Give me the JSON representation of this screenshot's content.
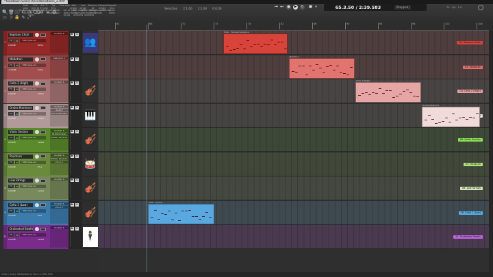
{
  "window": {
    "tab_title": "*Teardown-Score-Reverberations_2.RPP"
  },
  "toolbar": {
    "buttons": [
      "Auto color Color tracks",
      "Trim item to Color",
      "Act. Tr. E Color items",
      "Tgl. Env. Color items",
      "Overview",
      "Add empty take items",
      "Add empty take after",
      "Remove all empty takes",
      "Collapse empty take",
      "Explode into colour items",
      "Glue",
      "Copy Sel. items",
      "Super Glue",
      "Super Glue",
      "Super Glue",
      "Set all items to lag",
      "Normalize items loudness",
      "Normalize take loudness",
      "Auto-Render",
      "Edit list",
      "Ruler",
      "Snap",
      "Lock",
      "Env",
      "Zoom",
      "Grid",
      "Playhead",
      "Auto",
      "Time",
      "Items",
      "Envelopes",
      "Markers"
    ],
    "selection_label": "Selection",
    "sel_start": "2:1.00",
    "sel_end": "2:1.00",
    "sel_len": "0:0.00"
  },
  "transport": {
    "time": "65.3.50 / 2:39.583",
    "state": "[Stopped]",
    "bpm": "70",
    "sig": "3/4",
    "rate": "1.0"
  },
  "ruler": [
    "62",
    "66",
    "70",
    "74",
    "78",
    "82",
    "86",
    "90",
    "94",
    "98",
    "102",
    "106"
  ],
  "tracks": [
    {
      "num": "2",
      "name": "Soprano Choir",
      "vol": "0.00dB",
      "pan": "90%L",
      "fx": [
        "Kontakt 6"
      ],
      "color": "#962828",
      "lane": "#4e3e3e",
      "icon": "👥",
      "tag": "02. Soprano Choir",
      "tagc": "#d9423a"
    },
    {
      "num": "3",
      "name": "Mellotron",
      "vol": "-3.00dB",
      "pan": "54%L",
      "fx": [
        "Mellotron V"
      ],
      "color": "#a04e4e",
      "lane": "#4e3e3e",
      "icon": "",
      "tag": "03. Mellotron",
      "tagc": "#e27070"
    },
    {
      "num": "4",
      "name": "Cello 2 (High)",
      "vol": "0.00dB",
      "pan": "90%R",
      "fx": [
        "Kontakt 6"
      ],
      "color": "#a87676",
      "lane": "#484444",
      "icon": "🎻",
      "tag": "04. Cello 2 (High)",
      "tagc": "#e8a0a0"
    },
    {
      "num": "5",
      "name": "Ondes Martenot",
      "vol": "2.70dB",
      "pan": "23%R",
      "fx": [
        "Kontakt 6",
        "ReaEQ",
        "Pro-Q Ultimate"
      ],
      "color": "#b39a9a",
      "lane": "#464343",
      "icon": "🎹",
      "tag": "05. Ondes Martenot",
      "tagc": "#f0d8d8"
    },
    {
      "num": "6",
      "name": "Violin Section",
      "vol": "0.00dB",
      "pan": "center",
      "fx": [
        "Kontakt 6",
        "BLEASS Delay",
        "Eleken Reverse"
      ],
      "color": "#5a8a2c",
      "lane": "#3e4838",
      "icon": "🎻",
      "tag": "06. Violin Section",
      "tagc": "#8ee05a"
    },
    {
      "num": "7",
      "name": "Pandrum",
      "vol": "0.00dB",
      "pan": "9%L",
      "fx": [
        "Kontakt 6",
        "Eleken Reverse",
        "Pro-C 2"
      ],
      "color": "#6a8a3c",
      "lane": "#41483a",
      "icon": "🥁",
      "tag": "07. Pandrum",
      "tagc": "#b2e07a"
    },
    {
      "num": "8",
      "name": "Low Strings",
      "vol": "0.00dB",
      "pan": "center",
      "fx": [
        "Kontakt 6"
      ],
      "color": "#788a5c",
      "lane": "#444840",
      "icon": "🎻",
      "tag": "08. Low Strings",
      "tagc": "#d6e8b8"
    },
    {
      "num": "9",
      "name": "Cello 1 (Low)",
      "vol": "0.00dB",
      "pan": "9%L",
      "fx": [
        "Kontakt 6",
        "Pro-C 2"
      ],
      "color": "#3c7cac",
      "lane": "#3e4a50",
      "icon": "🎻",
      "tag": "09. Cello 1 (Low)",
      "tagc": "#5aaee8"
    },
    {
      "num": "11",
      "name": "Orchestral Swells",
      "vol": "0.00dB",
      "pan": "center",
      "fx": [
        "Kontakt 6"
      ],
      "color": "#7a2c8c",
      "lane": "#4a3a50",
      "icon": "🕴",
      "tag": "11. Orchestral Swells",
      "tagc": "#c066e0"
    }
  ],
  "midi_out": "MIDI (bus-us)",
  "fx_label": "FX",
  "items": [
    {
      "track": 0,
      "label": "Choir - Female Sopranos",
      "start": 0.32,
      "len": 0.165,
      "color": "#d8433a"
    },
    {
      "track": 1,
      "label": "Mellotron",
      "start": 0.488,
      "len": 0.168,
      "color": "#e27470"
    },
    {
      "track": 2,
      "label": "Cello 2 (High)",
      "start": 0.658,
      "len": 0.168,
      "color": "#e6a6a6"
    },
    {
      "track": 3,
      "label": "Ondes Martenot",
      "start": 0.828,
      "len": 0.15,
      "color": "#f0dada"
    },
    {
      "track": 7,
      "label": "Cello 1 (Low)",
      "start": 0.128,
      "len": 0.17,
      "color": "#5aa8e0"
    }
  ],
  "status": "Cello 1 (Low): 3/8 Kontakt 6, Pro-C 2: 99% 99%"
}
